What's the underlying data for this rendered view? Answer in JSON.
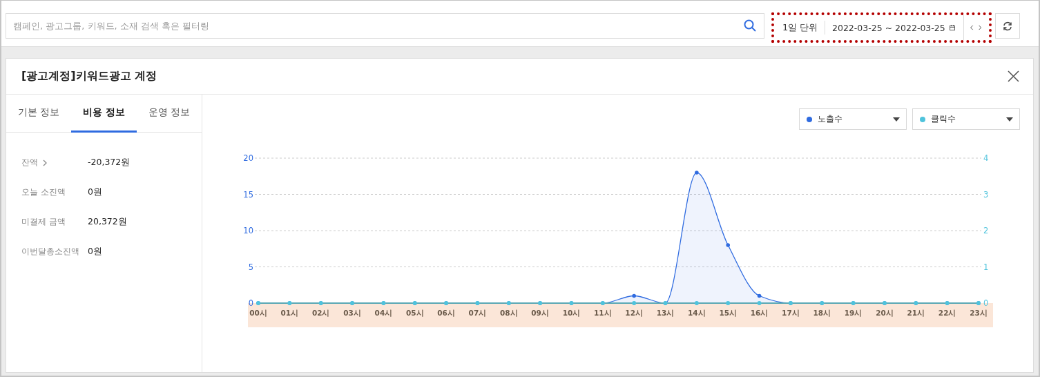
{
  "search": {
    "placeholder": "캠페인, 광고그룹, 키워드, 소재 검색 혹은 필터링"
  },
  "date_range": {
    "unit": "1일 단위",
    "range": "2022-03-25 ~ 2022-03-25"
  },
  "panel": {
    "title": "[광고계정]키워드광고 계정",
    "tabs": [
      {
        "label": "기본 정보",
        "selected": false
      },
      {
        "label": "비용 정보",
        "selected": true
      },
      {
        "label": "운영 정보",
        "selected": false
      }
    ],
    "info_rows": [
      {
        "label": "잔액",
        "value": "-20,372원",
        "kind": "link"
      },
      {
        "label": "오늘 소진액",
        "value": "0원",
        "kind": "plain"
      },
      {
        "label": "미결제 금액",
        "value": "20,372원",
        "kind": "plain"
      },
      {
        "label": "이번달총소진액",
        "value": "0원",
        "kind": "plain"
      }
    ],
    "chart_data": {
      "type": "line",
      "categories": [
        "00시",
        "01시",
        "02시",
        "03시",
        "04시",
        "05시",
        "06시",
        "07시",
        "08시",
        "09시",
        "10시",
        "11시",
        "12시",
        "13시",
        "14시",
        "15시",
        "16시",
        "17시",
        "18시",
        "19시",
        "20시",
        "21시",
        "22시",
        "23시"
      ],
      "series": [
        {
          "name": "노출수",
          "color": "#2f6be0",
          "marker": true,
          "values": [
            0,
            0,
            0,
            0,
            0,
            0,
            0,
            0,
            0,
            0,
            0,
            0,
            1,
            0,
            18,
            8,
            1,
            0,
            0,
            0,
            0,
            0,
            0,
            0
          ]
        },
        {
          "name": "클릭수",
          "color": "#4fc3dc",
          "marker": true,
          "values": [
            0,
            0,
            0,
            0,
            0,
            0,
            0,
            0,
            0,
            0,
            0,
            0,
            0,
            0,
            0,
            0,
            0,
            0,
            0,
            0,
            0,
            0,
            0,
            0
          ]
        }
      ],
      "grid": true,
      "ylim": [
        0,
        20
      ],
      "yticks": [
        0,
        5,
        10,
        15,
        20
      ],
      "y2lim": [
        0,
        4
      ],
      "y2ticks": [
        0,
        1,
        2,
        3,
        4
      ]
    }
  }
}
